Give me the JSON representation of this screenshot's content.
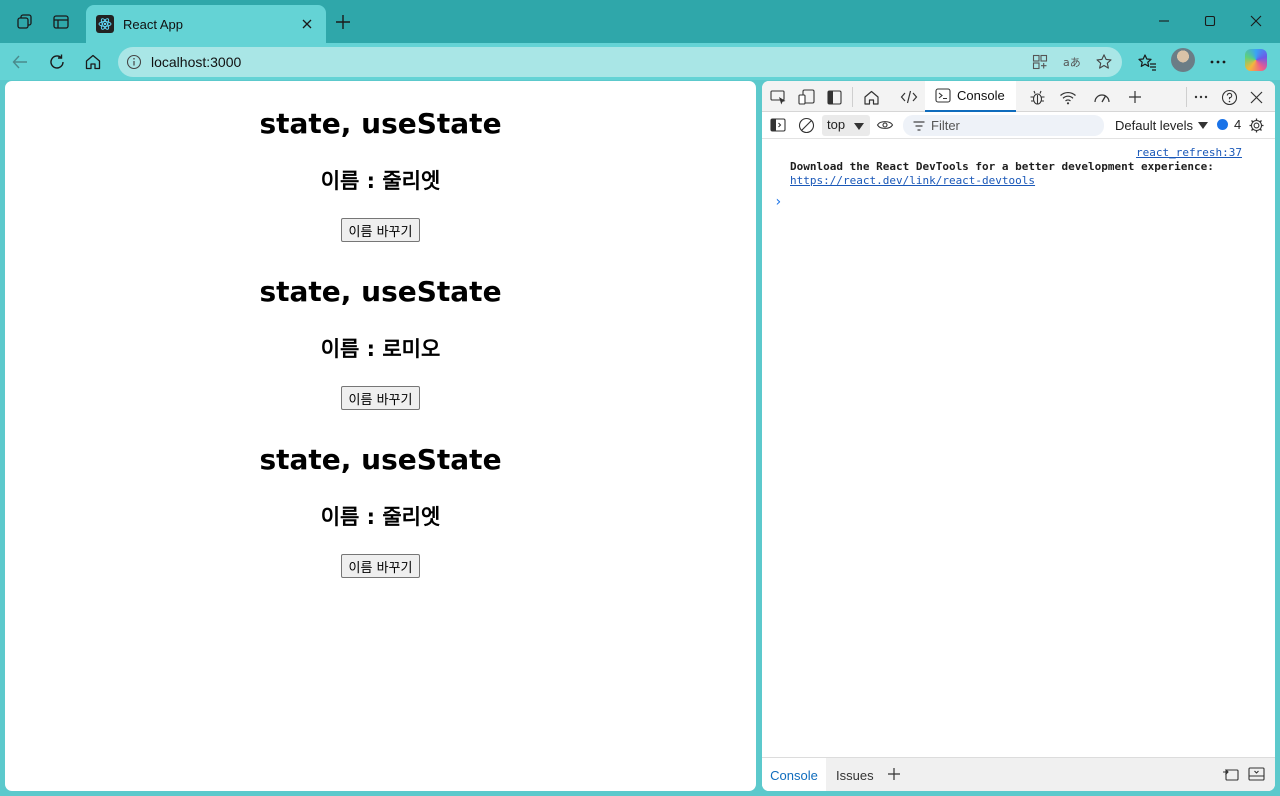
{
  "browser": {
    "tab_title": "React App",
    "url": "localhost:3000",
    "accent": "#2fa7aa",
    "toolbar_color": "#64d3d5"
  },
  "page": {
    "blocks": [
      {
        "heading": "state, useState",
        "name_line": "이름 : 줄리엣",
        "button_label": "이름 바꾸기"
      },
      {
        "heading": "state, useState",
        "name_line": "이름 : 로미오",
        "button_label": "이름 바꾸기"
      },
      {
        "heading": "state, useState",
        "name_line": "이름 : 줄리엣",
        "button_label": "이름 바꾸기"
      }
    ]
  },
  "devtools": {
    "active_tab": "Console",
    "context": "top",
    "filter_placeholder": "Filter",
    "levels": "Default levels",
    "message_count": "4",
    "console": {
      "source": "react_refresh:37",
      "message": "Download the React DevTools for a better development experience:",
      "link": "https://react.dev/link/react-devtools",
      "prompt": "›"
    },
    "drawer": {
      "tabs": [
        "Console",
        "Issues"
      ]
    }
  }
}
